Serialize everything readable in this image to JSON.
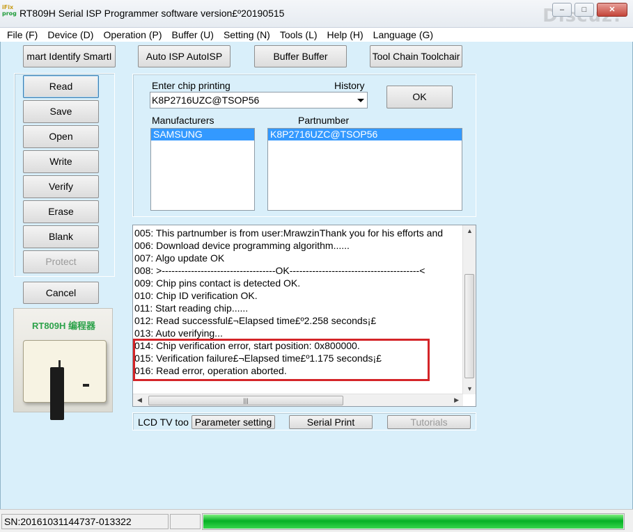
{
  "window": {
    "title": "RT809H Serial ISP Programmer software version£º20190515",
    "icon_text_top": "iFix",
    "icon_text_bottom": "prog",
    "watermark": "Discuz!",
    "buttons": [
      "minimize",
      "maximize",
      "close"
    ]
  },
  "menu": [
    "File (F)",
    "Device (D)",
    "Operation (P)",
    "Buffer (U)",
    "Setting (N)",
    "Tools (L)",
    "Help (H)",
    "Language (G)"
  ],
  "toolbar": {
    "smart_identify": "mart Identify SmartI",
    "auto_isp": "Auto ISP AutoISP",
    "buffer": "Buffer Buffer",
    "tool_chain": "Tool Chain Toolchair"
  },
  "side_buttons": {
    "read": "Read",
    "save": "Save",
    "open": "Open",
    "write": "Write",
    "verify": "Verify",
    "erase": "Erase",
    "blank": "Blank",
    "protect": "Protect",
    "cancel": "Cancel"
  },
  "device_image": {
    "caption": "RT809H 编程器"
  },
  "chip": {
    "enter_label": "Enter chip printing",
    "history_label": "History",
    "combo_value": "K8P2716UZC@TSOP56",
    "ok_label": "OK",
    "manufacturers_label": "Manufacturers",
    "partnumber_label": "Partnumber",
    "manufacturers": [
      "SAMSUNG"
    ],
    "partnumbers": [
      "K8P2716UZC@TSOP56"
    ]
  },
  "log": [
    "005:  This partnumber is from user:MrawzinThank you for his efforts and",
    "006:  Download device programming algorithm......",
    "007:  Algo update OK",
    "008:  >-----------------------------------OK----------------------------------------<",
    "009:  Chip pins contact is detected OK.",
    "010:  Chip ID verification OK.",
    "011:  Start reading chip......",
    "012:  Read successful£¬Elapsed time£º2.258 seconds¡£",
    "013:  Auto verifying...",
    "014:  Chip verification error, start position: 0x800000.",
    "015:  Verification failure£¬Elapsed time£º1.175 seconds¡£",
    "016:  Read error, operation aborted."
  ],
  "bottom_tools": {
    "lcd_label": "LCD TV too",
    "parameter_setting": "Parameter setting",
    "serial_print": "Serial Print",
    "tutorials": "Tutorials"
  },
  "status": {
    "sn": "SN:20161031144737-013322",
    "progress": 1.0,
    "progress_color": "#06b025"
  },
  "colors": {
    "client_bg": "#d9effa",
    "highlight": "#d42428",
    "selection": "#3399ff"
  }
}
